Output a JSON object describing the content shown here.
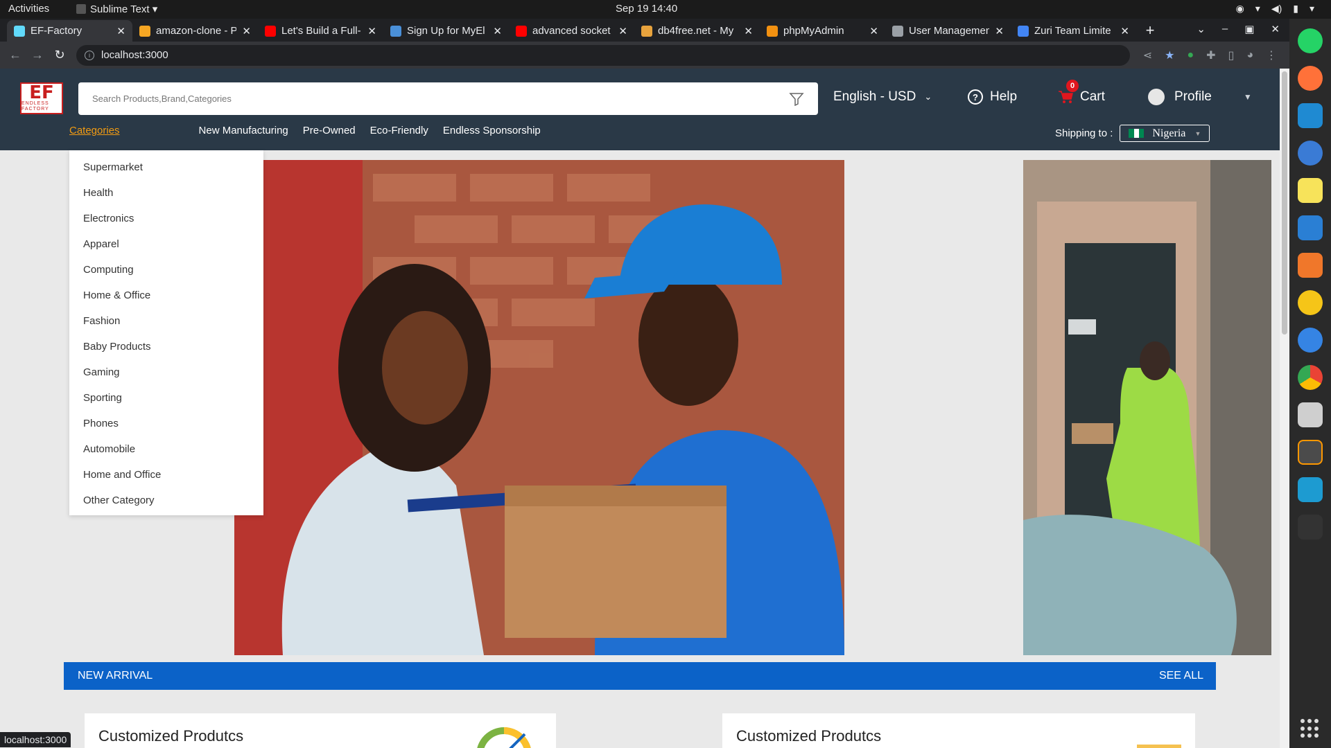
{
  "os": {
    "activities": "Activities",
    "app_menu": "Sublime Text ▾",
    "clock": "Sep 19  14:40"
  },
  "browser": {
    "tabs": [
      {
        "title": "EF-Factory",
        "color": "#61dafb"
      },
      {
        "title": "amazon-clone - P",
        "color": "#f5a623"
      },
      {
        "title": "Let's Build a Full-",
        "color": "#ff0000"
      },
      {
        "title": "Sign Up for MyEl",
        "color": "#4a90d9"
      },
      {
        "title": "advanced socket",
        "color": "#ff0000"
      },
      {
        "title": "db4free.net - My",
        "color": "#e8a33d"
      },
      {
        "title": "phpMyAdmin",
        "color": "#f29111"
      },
      {
        "title": "User Managemen",
        "color": "#9aa0a6"
      },
      {
        "title": "Zuri Team Limite",
        "color": "#4285f4"
      }
    ],
    "url": "localhost:3000",
    "status_url": "localhost:3000"
  },
  "site": {
    "logo_mark": "EF",
    "logo_sub": "ENDLESS FACTORY",
    "search_placeholder": "Search Products,Brand,Categories",
    "language": "English - USD",
    "help": "Help",
    "cart_label": "Cart",
    "cart_count": "0",
    "profile": "Profile",
    "nav": {
      "categories": "Categories",
      "links": [
        "New Manufacturing",
        "Pre-Owned",
        "Eco-Friendly",
        "Endless Sponsorship"
      ]
    },
    "shipping_label": "Shipping to :",
    "country": "Nigeria",
    "categories_menu": [
      "Supermarket",
      "Health",
      "Electronics",
      "Apparel",
      "Computing",
      "Home & Office",
      "Fashion",
      "Baby Products",
      "Gaming",
      "Sporting",
      "Phones",
      "Automobile",
      "Home and Office",
      "Other Category"
    ],
    "banner": {
      "left": "NEW ARRIVAL",
      "right": "SEE ALL"
    },
    "cards": [
      "Customized Produtcs",
      "Customized Produtcs"
    ]
  },
  "colors": {
    "header_bg": "#2a3947",
    "accent_orange": "#f39c12",
    "banner_blue": "#0b62c8",
    "cart_badge": "#e0161e"
  }
}
